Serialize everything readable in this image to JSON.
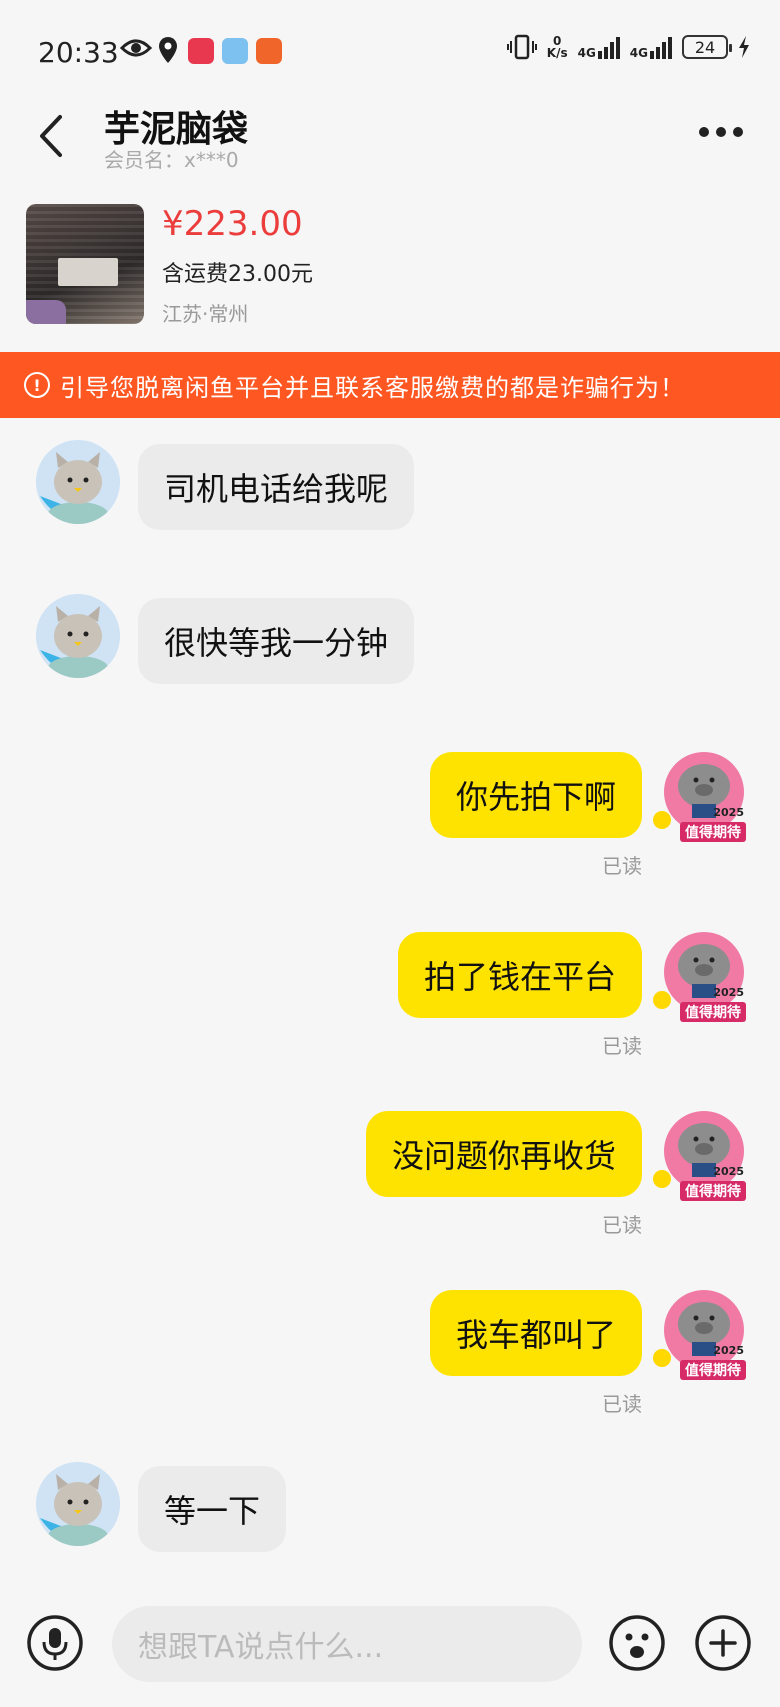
{
  "status_bar": {
    "time": "20:33",
    "network_speed_value": "0",
    "network_speed_unit": "K/s",
    "net1": "4G",
    "net2": "4G",
    "battery": "24"
  },
  "header": {
    "title": "芋泥脑袋",
    "member_name": "会员名：x***0"
  },
  "product": {
    "price": "¥223.00",
    "shipping": "含运费23.00元",
    "location": "江苏·常州"
  },
  "warning": {
    "text": "引导您脱离闲鱼平台并且联系客服缴费的都是诈骗行为！"
  },
  "messages": [
    {
      "side": "in",
      "text": "司机电话给我呢"
    },
    {
      "side": "in",
      "text": "很快等我一分钟"
    },
    {
      "side": "out",
      "text": "你先拍下啊",
      "status": "已读"
    },
    {
      "side": "out",
      "text": "拍了钱在平台",
      "status": "已读"
    },
    {
      "side": "out",
      "text": "没问题你再收货",
      "status": "已读"
    },
    {
      "side": "out",
      "text": "我车都叫了",
      "status": "已读"
    },
    {
      "side": "in",
      "text": "等一下"
    }
  ],
  "input": {
    "placeholder": "想跟TA说点什么..."
  },
  "avatar_badge": {
    "year": "2025",
    "slogan": "值得期待"
  },
  "colors": {
    "accent_yellow": "#ffe300",
    "warning_orange": "#ff5722",
    "price_red": "#ec3d3d"
  }
}
